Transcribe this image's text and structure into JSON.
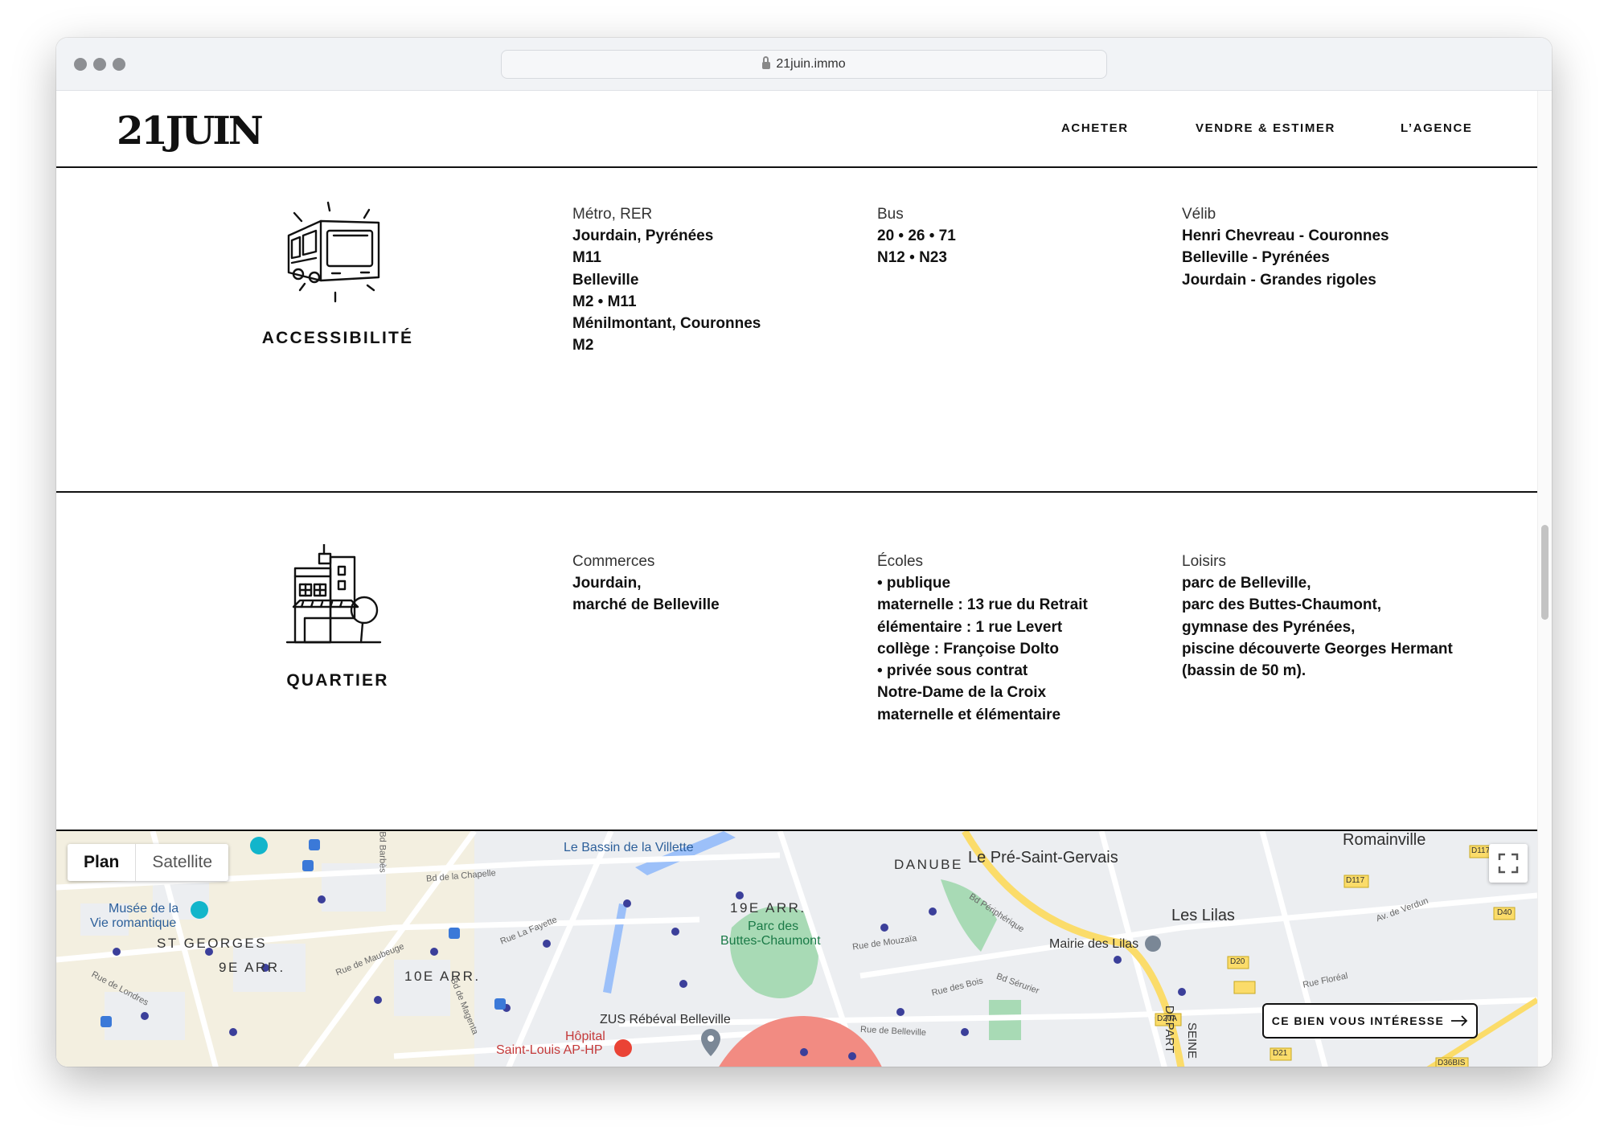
{
  "browser": {
    "url": "21juin.immo"
  },
  "header": {
    "logo": "21JUIN",
    "nav": {
      "buy": "ACHETER",
      "sell": "VENDRE & ESTIMER",
      "agency": "L’AGENCE"
    }
  },
  "accessibility": {
    "title": "ACCESSIBILITÉ",
    "icon": "bus-icon",
    "metro": {
      "label": "Métro, RER",
      "lines": [
        "Jourdain, Pyrénées",
        "M11",
        "Belleville",
        "M2 • M11",
        "Ménilmontant, Couronnes",
        "M2"
      ]
    },
    "bus": {
      "label": "Bus",
      "lines": [
        "20 • 26 • 71",
        "N12 • N23"
      ]
    },
    "velib": {
      "label": "Vélib",
      "lines": [
        "Henri Chevreau - Couronnes",
        "Belleville - Pyrénées",
        "Jourdain - Grandes rigoles"
      ]
    }
  },
  "neighborhood": {
    "title": "QUARTIER",
    "icon": "building-icon",
    "shops": {
      "label": "Commerces",
      "lines": [
        "Jourdain,",
        "marché de Belleville"
      ]
    },
    "schools": {
      "label": "Écoles",
      "lines": [
        "• publique",
        "maternelle : 13 rue du Retrait",
        "élémentaire : 1 rue Levert",
        "collège : Françoise Dolto",
        "• privée sous contrat",
        "Notre-Dame de la Croix",
        "maternelle et élémentaire"
      ]
    },
    "leisure": {
      "label": "Loisirs",
      "lines": [
        "parc de Belleville,",
        "parc des Buttes-Chaumont,",
        "gymnase des Pyrénées,",
        "piscine découverte Georges Hermant",
        "(bassin de 50 m)."
      ]
    }
  },
  "map": {
    "type_plan": "Plan",
    "type_satellite": "Satellite",
    "cta": "CE BIEN VOUS INTÉRESSE",
    "labels": {
      "bassin": "Le Bassin de la Villette",
      "danube": "DANUBE",
      "pre": "Le Pré-Saint-Gervais",
      "romainville": "Romainville",
      "musee1": "Musée de la",
      "musee2": "Vie romantique",
      "stgeorges": "ST GEORGES",
      "arr9": "9E ARR.",
      "arr10": "10E ARR.",
      "arr19": "19E ARR.",
      "parc1": "Parc des",
      "parc2": "Buttes-Chaumont",
      "lilas": "Les Lilas",
      "mairie": "Mairie des Lilas",
      "zus": "ZUS Rébéval Belleville",
      "hopital1": "Hôpital",
      "hopital2": "Saint-Louis AP-HP",
      "peripherique": "Bd Périphérique",
      "chapelle": "Bd de la Chapelle",
      "lafayette": "Rue La Fayette",
      "maubeuge": "Rue de Maubeuge",
      "londres": "Rue de Londres",
      "magenta": "Bd de Magenta",
      "mouzaia": "Rue de Mouzaïa",
      "bois": "Rue des Bois",
      "serurier": "Bd Sérurier",
      "bellevilleRue": "Rue de Belleville",
      "verdun": "Av. de Verdun",
      "floreal": "Rue Floréal",
      "barbes": "Bd Barbès",
      "depart": "DÉPART",
      "seine": "SEINE",
      "d117": "D117",
      "d40": "D40",
      "d20": "D20",
      "d20a": "D20A",
      "d21": "D21",
      "d36bis": "D36BIS",
      "d11": "D117"
    },
    "colors": {
      "park": "#a8dab5",
      "water": "#9cc0f9",
      "highway": "#fbdc6a",
      "zone": "#f28b82",
      "metro": "#3b3f9a"
    }
  }
}
